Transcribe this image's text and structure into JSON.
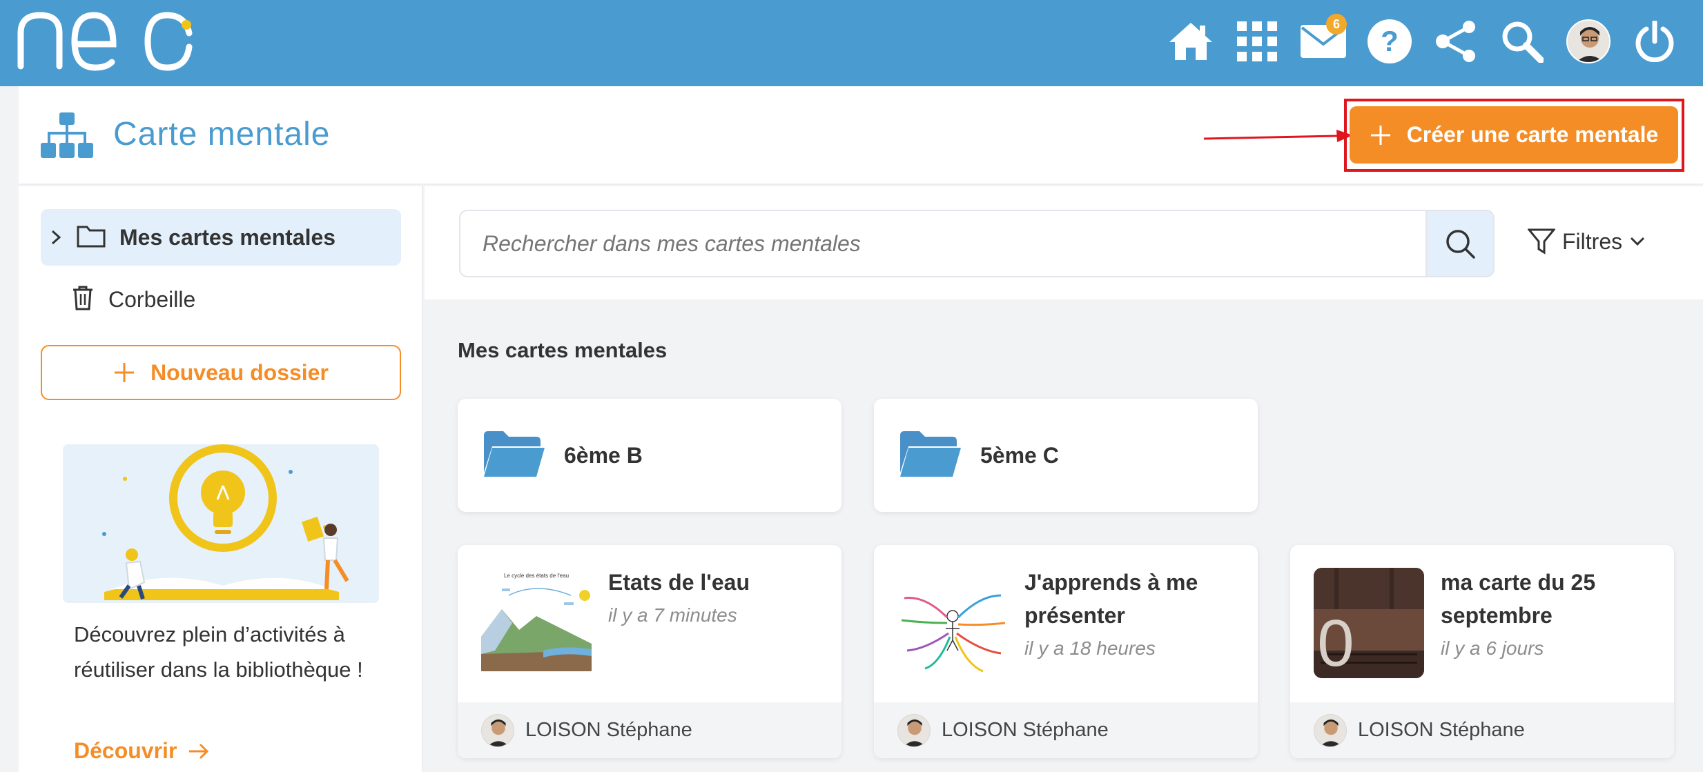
{
  "topbar": {
    "logo_text": "neo",
    "mail_badge_count": "6",
    "icons": [
      "home-icon",
      "apps-grid-icon",
      "mail-icon",
      "help-icon",
      "share-icon",
      "search-icon",
      "user-avatar",
      "power-icon"
    ]
  },
  "app": {
    "title": "Carte mentale",
    "create_button_label": "Créer une carte mentale"
  },
  "sidebar": {
    "items": [
      {
        "label": "Mes cartes mentales",
        "icon": "folder-icon",
        "selected": true
      },
      {
        "label": "Corbeille",
        "icon": "trash-icon",
        "selected": false
      }
    ],
    "new_folder_label": "Nouveau dossier",
    "promo_text": "Découvrez plein d’activités à réutiliser dans la bibliothèque !",
    "promo_link": "Découvrir"
  },
  "search": {
    "placeholder": "Rechercher dans mes cartes mentales",
    "filters_label": "Filtres"
  },
  "main": {
    "section_title": "Mes cartes mentales",
    "folders": [
      {
        "name": "6ème B"
      },
      {
        "name": "5ème C"
      }
    ],
    "maps": [
      {
        "title": "Etats de l'eau",
        "time": "il y a 7 minutes",
        "owner": "LOISON Stéphane",
        "thumbnail_text": "Le cycle des états de l'eau"
      },
      {
        "title": "J'apprends à me présenter",
        "time": "il y a 18 heures",
        "owner": "LOISON Stéphane",
        "thumbnail_text": ""
      },
      {
        "title": "ma carte du 25 septembre",
        "time": "il y a 6 jours",
        "owner": "LOISON Stéphane",
        "thumbnail_text": "0"
      }
    ]
  },
  "colors": {
    "topbar": "#4a9bd0",
    "accent_orange": "#f58d27",
    "highlight_red": "#e0161f",
    "selected_bg": "#e3f0fb"
  }
}
